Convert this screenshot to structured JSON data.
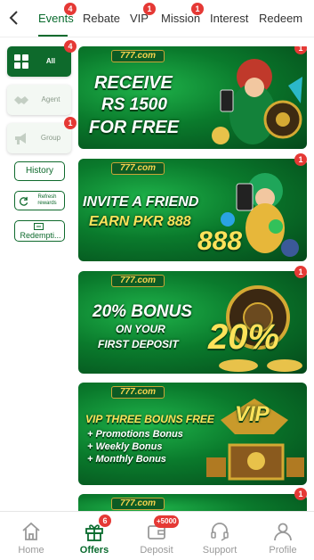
{
  "colors": {
    "accent": "#0a6b2e",
    "badge": "#e53935",
    "banner_green": "#0a7a2c",
    "gold": "#fde25a"
  },
  "topbar": {
    "back_icon": "chevron-left-icon",
    "tabs": [
      {
        "label": "Events",
        "badge": "4",
        "active": true
      },
      {
        "label": "Rebate",
        "badge": ""
      },
      {
        "label": "VIP",
        "badge": "1"
      },
      {
        "label": "Mission",
        "badge": "1"
      },
      {
        "label": "Interest",
        "badge": ""
      },
      {
        "label": "Redeem",
        "badge": ""
      }
    ]
  },
  "sidebar": {
    "categories": [
      {
        "label": "All",
        "badge": "4",
        "icon": "grid-icon",
        "active": true
      },
      {
        "label": "Agent",
        "badge": "",
        "icon": "handshake-icon"
      },
      {
        "label": "Group",
        "badge": "1",
        "icon": "megaphone-icon"
      }
    ],
    "history_label": "History",
    "refresh_label": "Refresh rewards",
    "redemption_label": "Redempti..."
  },
  "banners": [
    {
      "logo": "777.com",
      "line1": "RECEIVE",
      "line2": "RS 1500",
      "line3": "FOR FREE",
      "badge": "1"
    },
    {
      "logo": "777.com",
      "line1": "INVITE A FRIEND",
      "line2": "EARN PKR 888",
      "big": "888",
      "badge": "1"
    },
    {
      "logo": "777.com",
      "line1": "20% BONUS",
      "line2": "ON YOUR",
      "line3": "FIRST DEPOSIT",
      "big": "20%",
      "badge": "1"
    },
    {
      "logo": "777.com",
      "line1": "VIP THREE BOUNS FREE",
      "items": [
        "+ Promotions Bonus",
        "+ Weekly Bonus",
        "+ Monthly Bonus"
      ],
      "big": "VIP"
    },
    {
      "logo": "777.com",
      "badge": "1"
    }
  ],
  "bottomnav": [
    {
      "label": "Home",
      "icon": "home-icon",
      "badge": ""
    },
    {
      "label": "Offers",
      "icon": "gift-icon",
      "badge": "6",
      "active": true
    },
    {
      "label": "Deposit",
      "icon": "wallet-icon",
      "badge": "+5000"
    },
    {
      "label": "Support",
      "icon": "headset-icon",
      "badge": ""
    },
    {
      "label": "Profile",
      "icon": "user-icon",
      "badge": ""
    }
  ]
}
